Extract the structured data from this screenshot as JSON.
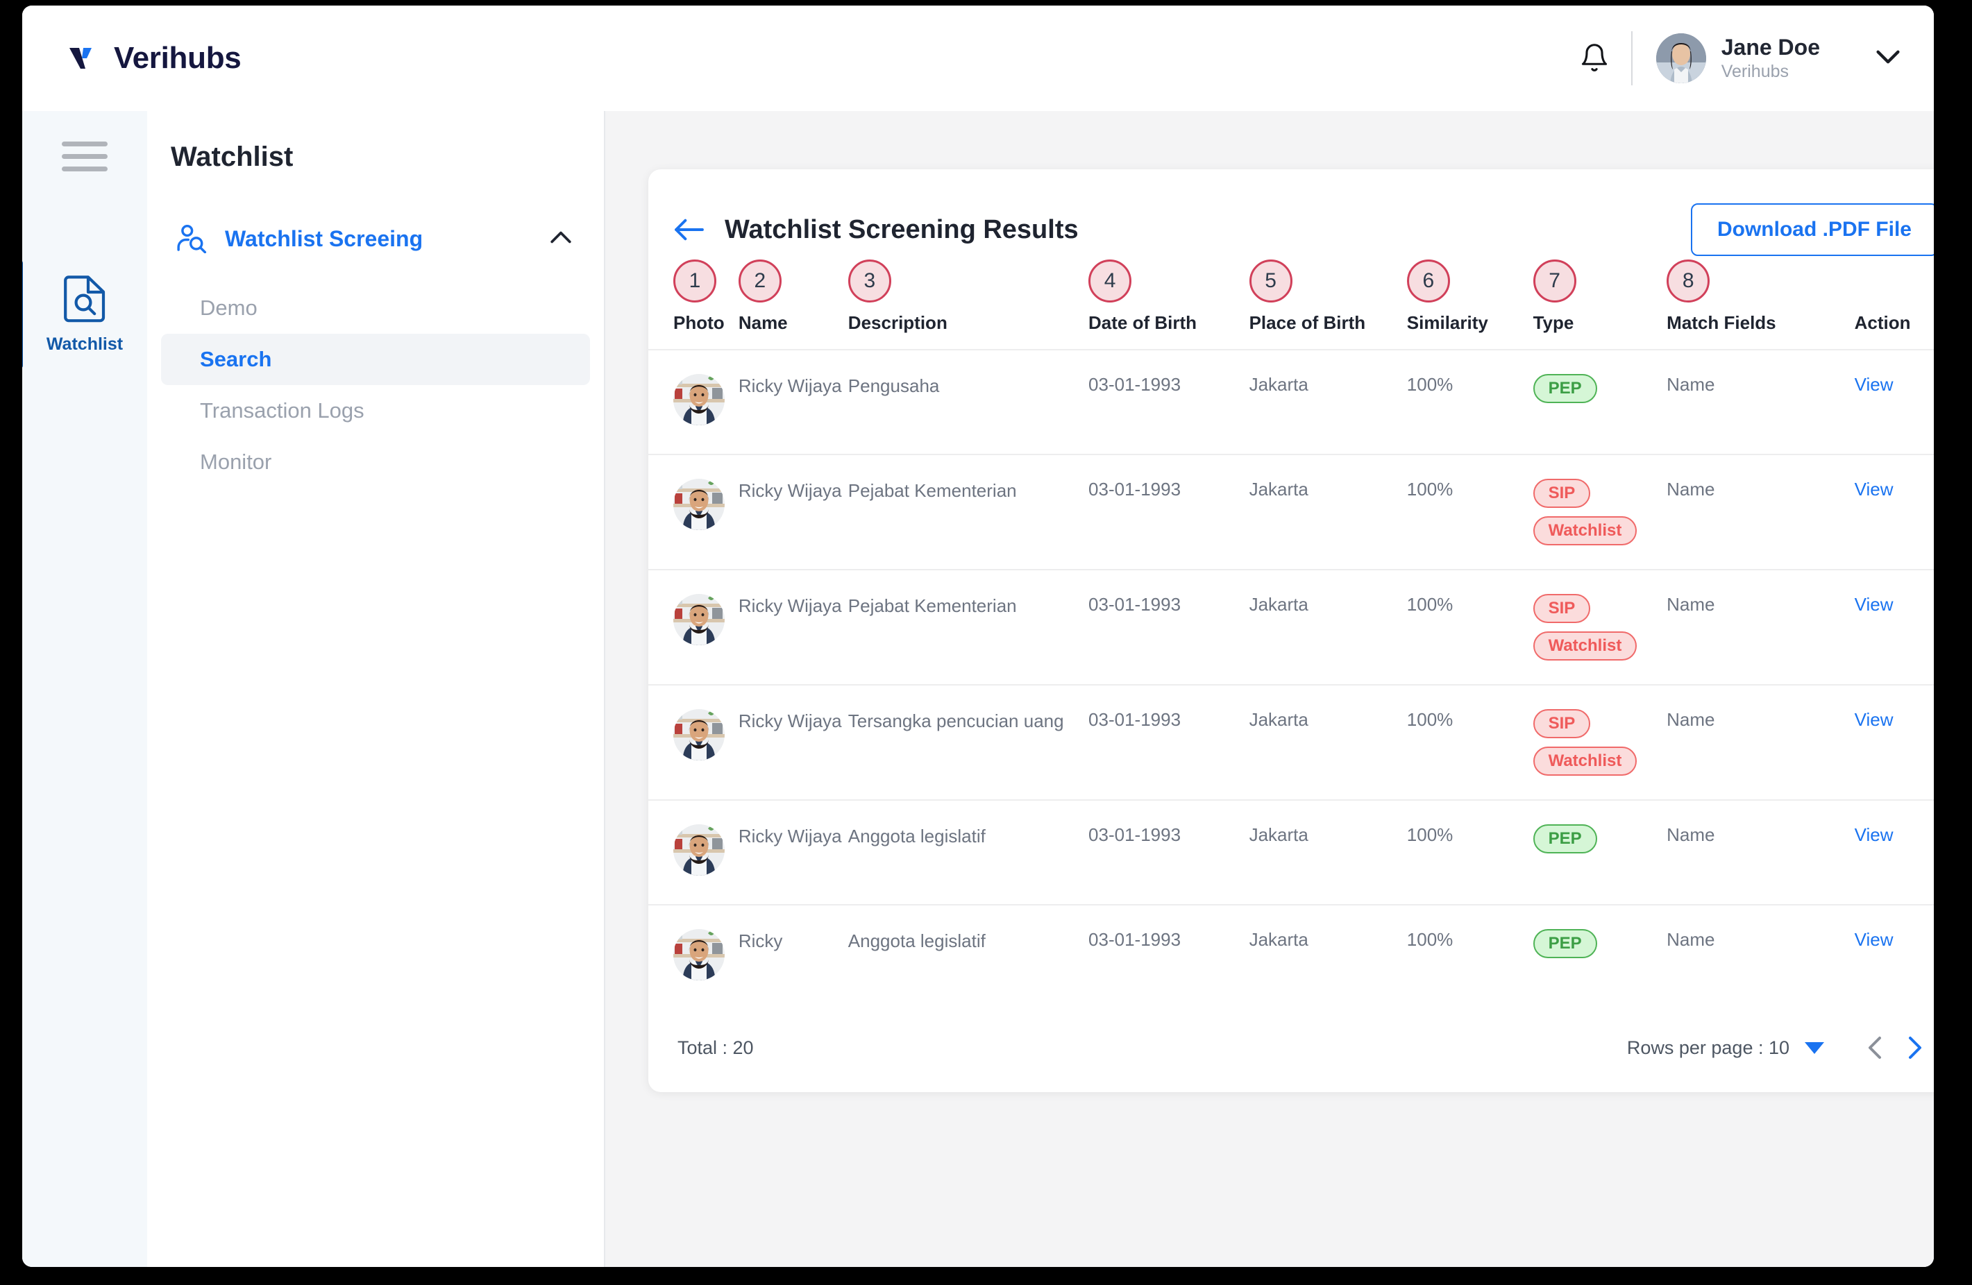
{
  "brand": {
    "name": "Verihubs",
    "mark": "v-logo-icon"
  },
  "header": {
    "bell": "notification-bell-icon",
    "user": {
      "name": "Jane Doe",
      "org": "Verihubs"
    },
    "chevron": "chevron-down-icon"
  },
  "rail": {
    "menu_icon": "hamburger-menu-icon",
    "items": [
      {
        "label": "Watchlist",
        "icon": "document-search-icon",
        "active": true
      }
    ]
  },
  "nav": {
    "title": "Watchlist",
    "group": {
      "label": "Watchlist Screeing",
      "icon": "user-search-icon",
      "chevron": "chevron-up-icon"
    },
    "items": [
      {
        "label": "Demo",
        "active": false
      },
      {
        "label": "Search",
        "active": true
      },
      {
        "label": "Transaction Logs",
        "active": false
      },
      {
        "label": "Monitor",
        "active": false
      }
    ]
  },
  "card": {
    "back_icon": "arrow-left-icon",
    "title": "Watchlist Screening Results",
    "download_label": "Download .PDF File",
    "columns": [
      {
        "badge": "1",
        "label": "Photo"
      },
      {
        "badge": "2",
        "label": "Name"
      },
      {
        "badge": "3",
        "label": "Description"
      },
      {
        "badge": "4",
        "label": "Date of Birth"
      },
      {
        "badge": "5",
        "label": "Place of Birth"
      },
      {
        "badge": "6",
        "label": "Similarity"
      },
      {
        "badge": "7",
        "label": "Type"
      },
      {
        "badge": "8",
        "label": "Match Fields"
      },
      {
        "badge": "",
        "label": "Action"
      }
    ],
    "rows": [
      {
        "photo": "person-avatar",
        "name": "Ricky Wijaya",
        "description": "Pengusaha",
        "dob": "03-01-1993",
        "pob": "Jakarta",
        "similarity": "100%",
        "tags": [
          {
            "text": "PEP",
            "color": "green"
          }
        ],
        "match_fields": "Name",
        "action": "View"
      },
      {
        "photo": "person-avatar",
        "name": "Ricky Wijaya",
        "description": "Pejabat Kementerian",
        "dob": "03-01-1993",
        "pob": "Jakarta",
        "similarity": "100%",
        "tags": [
          {
            "text": "SIP",
            "color": "red"
          },
          {
            "text": "Watchlist",
            "color": "red"
          }
        ],
        "match_fields": "Name",
        "action": "View"
      },
      {
        "photo": "person-avatar",
        "name": "Ricky Wijaya",
        "description": "Pejabat Kementerian",
        "dob": "03-01-1993",
        "pob": "Jakarta",
        "similarity": "100%",
        "tags": [
          {
            "text": "SIP",
            "color": "red"
          },
          {
            "text": "Watchlist",
            "color": "red"
          }
        ],
        "match_fields": "Name",
        "action": "View"
      },
      {
        "photo": "person-avatar",
        "name": "Ricky Wijaya",
        "description": "Tersangka pencucian uang",
        "dob": "03-01-1993",
        "pob": "Jakarta",
        "similarity": "100%",
        "tags": [
          {
            "text": "SIP",
            "color": "red"
          },
          {
            "text": "Watchlist",
            "color": "red"
          }
        ],
        "match_fields": "Name",
        "action": "View"
      },
      {
        "photo": "person-avatar",
        "name": "Ricky Wijaya",
        "description": "Anggota legislatif",
        "dob": "03-01-1993",
        "pob": "Jakarta",
        "similarity": "100%",
        "tags": [
          {
            "text": "PEP",
            "color": "green"
          }
        ],
        "match_fields": "Name",
        "action": "View"
      },
      {
        "photo": "person-avatar",
        "name": "Ricky",
        "description": "Anggota legislatif",
        "dob": "03-01-1993",
        "pob": "Jakarta",
        "similarity": "100%",
        "tags": [
          {
            "text": "PEP",
            "color": "green"
          }
        ],
        "match_fields": "Name",
        "action": "View"
      }
    ],
    "footer": {
      "total": "Total : 20",
      "rows_per_page": "Rows per page : 10",
      "prev_icon": "chevron-left-icon",
      "next_icon": "chevron-right-icon"
    }
  },
  "colors": {
    "brand_navy": "#15173f",
    "accent_blue": "#1a73f0",
    "rail_blue": "#1259a8",
    "badge_border": "#d1405a",
    "badge_fill": "#f7dee1",
    "tag_green": "#4fb356",
    "tag_red": "#f06a6a",
    "content_bg": "#f4f4f5"
  }
}
